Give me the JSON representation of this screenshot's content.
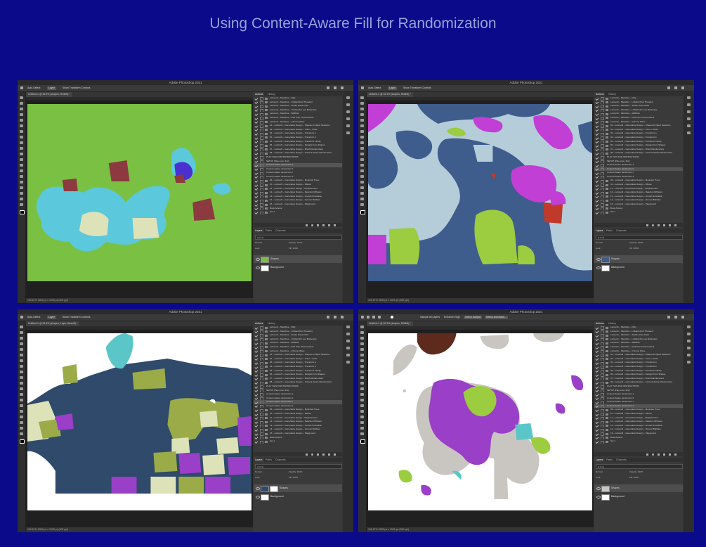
{
  "page": {
    "title": "Using Content-Aware Fill for Randomization"
  },
  "app": {
    "title": "Adobe Photoshop 2021"
  },
  "panels": {
    "actions_tab": "Actions",
    "history_tab": "History",
    "layers_tab": "Layers",
    "paths_tab": "Paths",
    "channels_tab": "Channels"
  },
  "layers": {
    "kind_label": "Q Kind",
    "blend_mode": "Normal",
    "opacity": "Opacity: 100%",
    "lock": "Lock:",
    "fill": "Fill: 100%",
    "shapes_label": "Shapes",
    "background_label": "Background"
  },
  "windows": [
    {
      "doc_tab": "Untitled-1 @ 33.3% (shapes, RGB/8) *",
      "status": "100.67%   3000 px x 1000 px (300 ppi)",
      "options": {
        "auto_select": "Auto-Select:",
        "layer": "Layer",
        "show_transform": "Show Transform Controls"
      },
      "actions": [
        {
          "label": "Lehoux9 – Sketches – Ditty",
          "type": "folder",
          "highlight": false
        },
        {
          "label": "Lehoux9 – Sketches – Untitled (Fort Thunder)",
          "type": "folder",
          "highlight": false
        },
        {
          "label": "Lehoux9 – Sketches – Textile Noise Field",
          "type": "folder",
          "highlight": false
        },
        {
          "label": "Lehoux9 – Sketches – Untitled (for Lea Borderies)",
          "type": "folder",
          "highlight": false
        },
        {
          "label": "Lehoux9 – Sketches – Wildflow",
          "type": "folder",
          "highlight": false
        },
        {
          "label": "Lehoux9 – Sketches – Red Print Chrome Rock",
          "type": "folder",
          "highlight": false
        },
        {
          "label": "Lehoux9 – Sketches – Chrome Wave",
          "type": "folder",
          "highlight": false
        },
        {
          "label": "01 – Lehoux9 – Generative Design – Shapes & Object Selection",
          "type": "folder",
          "highlight": false
        },
        {
          "label": "02 – Lehoux9 – Generative Design – Color + Grids",
          "type": "folder",
          "highlight": false
        },
        {
          "label": "03 – Lehoux9 – Generative Design – Transform a",
          "type": "folder",
          "highlight": false
        },
        {
          "label": "04 – Lehoux9 – Generative Design – Transform b",
          "type": "folder",
          "highlight": false
        },
        {
          "label": "05 – Lehoux9 – Generative Design – Transform Infinity",
          "type": "folder",
          "highlight": false
        },
        {
          "label": "06 – Lehoux9 – Generative Design – Designs from Shapes",
          "type": "folder",
          "highlight": false
        },
        {
          "label": "07 – Lehoux9 – Generative Design – Brush Randomizers",
          "type": "folder",
          "highlight": false
        },
        {
          "label": "08 – Lehoux9 – Generative Design – Content-Aware Randomizers",
          "type": "folder",
          "highlight": false
        },
        {
          "label": "PLAY THIS FOR INSTRUCTIONS",
          "type": "sub",
          "highlight": false
        },
        {
          "label": "SETUP (Play once, first)",
          "type": "sub",
          "highlight": false
        },
        {
          "label": "Content-Aware randomizer a",
          "type": "sub",
          "highlight": true
        },
        {
          "label": "Content-Aware randomizer b",
          "type": "sub",
          "highlight": false
        },
        {
          "label": "Content-Aware randomizer c",
          "type": "sub",
          "highlight": false
        },
        {
          "label": "Content-Aware randomizer d",
          "type": "sub",
          "highlight": false
        },
        {
          "label": "09 – Lehoux9 – Generative Design – Mountain Trees",
          "type": "folder",
          "highlight": false
        },
        {
          "label": "10 – Lehoux9 – Generative Design – Waves",
          "type": "folder",
          "highlight": false
        },
        {
          "label": "11 – Lehoux9 – Generative Design – Displacement",
          "type": "folder",
          "highlight": false
        },
        {
          "label": "12 – Lehoux9 – Generative Design – Reaction Diffusion",
          "type": "folder",
          "highlight": false
        },
        {
          "label": "13 – Lehoux9 – Generative Design – Growth Simulation",
          "type": "folder",
          "highlight": false
        },
        {
          "label": "14 – Lehoux9 – Generative Design – Voronoi Bubbles",
          "type": "folder",
          "highlight": false
        },
        {
          "label": "15 – Lehoux9 – Generative Design – Playground",
          "type": "folder",
          "highlight": false
        },
        {
          "label": "Book Actions",
          "type": "folder",
          "highlight": false
        },
        {
          "label": "Set 1",
          "type": "folder",
          "highlight": false
        }
      ]
    },
    {
      "doc_tab": "Untitled-1 @ 33.3% (shapes, RGB/8) *",
      "status": "100.67%   3000 px x 1000 px (300 ppi)",
      "options": {
        "auto_select": "Auto-Select:",
        "layer": "Layer",
        "show_transform": "Show Transform Controls"
      },
      "actions": [
        {
          "label": "Lehoux9 – Sketches – Ditty",
          "type": "folder",
          "highlight": false
        },
        {
          "label": "Lehoux9 – Sketches – Untitled (Fort Thunder)",
          "type": "folder",
          "highlight": false
        },
        {
          "label": "Lehoux9 – Sketches – Textile Noise Field",
          "type": "folder",
          "highlight": false
        },
        {
          "label": "Lehoux9 – Sketches – Untitled (for Lea Borderies)",
          "type": "folder",
          "highlight": false
        },
        {
          "label": "Lehoux9 – Sketches – Wildflow",
          "type": "folder",
          "highlight": false
        },
        {
          "label": "Lehoux9 – Sketches – Red Print Chrome Rock",
          "type": "folder",
          "highlight": false
        },
        {
          "label": "Lehoux9 – Sketches – Chrome Wave",
          "type": "folder",
          "highlight": false
        },
        {
          "label": "01 – Lehoux9 – Generative Design – Shapes & Object Selection",
          "type": "folder",
          "highlight": false
        },
        {
          "label": "02 – Lehoux9 – Generative Design – Color + Grids",
          "type": "folder",
          "highlight": false
        },
        {
          "label": "03 – Lehoux9 – Generative Design – Transform a",
          "type": "folder",
          "highlight": false
        },
        {
          "label": "04 – Lehoux9 – Generative Design – Transform b",
          "type": "folder",
          "highlight": false
        },
        {
          "label": "05 – Lehoux9 – Generative Design – Transform Infinity",
          "type": "folder",
          "highlight": false
        },
        {
          "label": "06 – Lehoux9 – Generative Design – Designs from Shapes",
          "type": "folder",
          "highlight": false
        },
        {
          "label": "07 – Lehoux9 – Generative Design – Brush Randomizers",
          "type": "folder",
          "highlight": false
        },
        {
          "label": "08 – Lehoux9 – Generative Design – Content-Aware Randomizers",
          "type": "folder",
          "highlight": false
        },
        {
          "label": "PLAY THIS FOR INSTRUCTIONS",
          "type": "sub",
          "highlight": false
        },
        {
          "label": "SETUP (Play once, first)",
          "type": "sub",
          "highlight": false
        },
        {
          "label": "Content-Aware randomizer a",
          "type": "sub",
          "highlight": false
        },
        {
          "label": "Content-Aware randomizer b",
          "type": "sub",
          "highlight": true
        },
        {
          "label": "Content-Aware randomizer c",
          "type": "sub",
          "highlight": false
        },
        {
          "label": "Content-Aware randomizer d",
          "type": "sub",
          "highlight": false
        },
        {
          "label": "09 – Lehoux9 – Generative Design – Mountain Trees",
          "type": "folder",
          "highlight": false
        },
        {
          "label": "10 – Lehoux9 – Generative Design – Waves",
          "type": "folder",
          "highlight": false
        },
        {
          "label": "11 – Lehoux9 – Generative Design – Displacement",
          "type": "folder",
          "highlight": false
        },
        {
          "label": "12 – Lehoux9 – Generative Design – Reaction Diffusion",
          "type": "folder",
          "highlight": false
        },
        {
          "label": "13 – Lehoux9 – Generative Design – Growth Simulation",
          "type": "folder",
          "highlight": false
        },
        {
          "label": "14 – Lehoux9 – Generative Design – Voronoi Bubbles",
          "type": "folder",
          "highlight": false
        },
        {
          "label": "15 – Lehoux9 – Generative Design – Playground",
          "type": "folder",
          "highlight": false
        },
        {
          "label": "Book Actions",
          "type": "folder",
          "highlight": false
        },
        {
          "label": "Set 1",
          "type": "folder",
          "highlight": false
        }
      ]
    },
    {
      "doc_tab": "Untitled-1 @ 33.3% (shapes, Layer Mask/8) *",
      "status": "100.67%   3000 px x 1000 px (300 ppi)",
      "options": {
        "auto_select": "Auto-Select:",
        "layer": "Layer",
        "show_transform": "Show Transform Controls"
      },
      "actions": [
        {
          "label": "Lehoux9 – Sketches – Ditty",
          "type": "folder",
          "highlight": false
        },
        {
          "label": "Lehoux9 – Sketches – Untitled (Fort Thunder)",
          "type": "folder",
          "highlight": false
        },
        {
          "label": "Lehoux9 – Sketches – Textile Noise Field",
          "type": "folder",
          "highlight": false
        },
        {
          "label": "Lehoux9 – Sketches – Untitled (for Lea Borderies)",
          "type": "folder",
          "highlight": false
        },
        {
          "label": "Lehoux9 – Sketches – Wildflow",
          "type": "folder",
          "highlight": false
        },
        {
          "label": "Lehoux9 – Sketches – Red Print Chrome Rock",
          "type": "folder",
          "highlight": false
        },
        {
          "label": "Lehoux9 – Sketches – Chrome Wave",
          "type": "folder",
          "highlight": false
        },
        {
          "label": "01 – Lehoux9 – Generative Design – Shapes & Object Selection",
          "type": "folder",
          "highlight": false
        },
        {
          "label": "02 – Lehoux9 – Generative Design – Color + Grids",
          "type": "folder",
          "highlight": false
        },
        {
          "label": "03 – Lehoux9 – Generative Design – Transform a",
          "type": "folder",
          "highlight": false
        },
        {
          "label": "04 – Lehoux9 – Generative Design – Transform b",
          "type": "folder",
          "highlight": false
        },
        {
          "label": "05 – Lehoux9 – Generative Design – Transform Infinity",
          "type": "folder",
          "highlight": false
        },
        {
          "label": "06 – Lehoux9 – Generative Design – Designs from Shapes",
          "type": "folder",
          "highlight": false
        },
        {
          "label": "07 – Lehoux9 – Generative Design – Brush Randomizers",
          "type": "folder",
          "highlight": false
        },
        {
          "label": "08 – Lehoux9 – Generative Design – Content-Aware Randomizers",
          "type": "folder",
          "highlight": false
        },
        {
          "label": "PLAY THIS FOR INSTRUCTIONS",
          "type": "sub",
          "highlight": false
        },
        {
          "label": "SETUP (Play once, first)",
          "type": "sub",
          "highlight": false
        },
        {
          "label": "Content-Aware randomizer a",
          "type": "sub",
          "highlight": false
        },
        {
          "label": "Content-Aware randomizer b",
          "type": "sub",
          "highlight": false
        },
        {
          "label": "Content-Aware randomizer c",
          "type": "sub",
          "highlight": true
        },
        {
          "label": "Content-Aware randomizer d",
          "type": "sub",
          "highlight": false
        },
        {
          "label": "09 – Lehoux9 – Generative Design – Mountain Trees",
          "type": "folder",
          "highlight": false
        },
        {
          "label": "10 – Lehoux9 – Generative Design – Waves",
          "type": "folder",
          "highlight": false
        },
        {
          "label": "11 – Lehoux9 – Generative Design – Displacement",
          "type": "folder",
          "highlight": false
        },
        {
          "label": "12 – Lehoux9 – Generative Design – Reaction Diffusion",
          "type": "folder",
          "highlight": false
        },
        {
          "label": "13 – Lehoux9 – Generative Design – Growth Simulation",
          "type": "folder",
          "highlight": false
        },
        {
          "label": "14 – Lehoux9 – Generative Design – Voronoi Bubbles",
          "type": "folder",
          "highlight": false
        },
        {
          "label": "15 – Lehoux9 – Generative Design – Playground",
          "type": "folder",
          "highlight": false
        },
        {
          "label": "Book Actions",
          "type": "folder",
          "highlight": false
        },
        {
          "label": "Set 1",
          "type": "folder",
          "highlight": false
        }
      ]
    },
    {
      "doc_tab": "Untitled-1 @ 33.3% (shapes, RGB/8) *",
      "status": "100.67%   3000 px x 1000 px (300 ppi)",
      "options": {
        "sample_all": "Sample All Layers",
        "enhance_edge": "Enhance Edge",
        "select_subject": "Select Subject",
        "select_mask": "Select and Mask..."
      },
      "actions": [
        {
          "label": "Lehoux9 – Sketches – Ditty",
          "type": "folder",
          "highlight": false
        },
        {
          "label": "Lehoux9 – Sketches – Untitled (Fort Thunder)",
          "type": "folder",
          "highlight": false
        },
        {
          "label": "Lehoux9 – Sketches – Textile Noise Field",
          "type": "folder",
          "highlight": false
        },
        {
          "label": "Lehoux9 – Sketches – Untitled (for Lea Borderies)",
          "type": "folder",
          "highlight": false
        },
        {
          "label": "Lehoux9 – Sketches – Wildflow",
          "type": "folder",
          "highlight": false
        },
        {
          "label": "Lehoux9 – Sketches – Red Print Chrome Rock",
          "type": "folder",
          "highlight": false
        },
        {
          "label": "Lehoux9 – Sketches – Chrome Wave",
          "type": "folder",
          "highlight": false
        },
        {
          "label": "01 – Lehoux9 – Generative Design – Shapes & Object Selection",
          "type": "folder",
          "highlight": false
        },
        {
          "label": "02 – Lehoux9 – Generative Design – Color + Grids",
          "type": "folder",
          "highlight": false
        },
        {
          "label": "03 – Lehoux9 – Generative Design – Transform a",
          "type": "folder",
          "highlight": false
        },
        {
          "label": "04 – Lehoux9 – Generative Design – Transform b",
          "type": "folder",
          "highlight": false
        },
        {
          "label": "05 – Lehoux9 – Generative Design – Transform Infinity",
          "type": "folder",
          "highlight": false
        },
        {
          "label": "06 – Lehoux9 – Generative Design – Designs from Shapes",
          "type": "folder",
          "highlight": false
        },
        {
          "label": "07 – Lehoux9 – Generative Design – Brush Randomizers",
          "type": "folder",
          "highlight": false
        },
        {
          "label": "08 – Lehoux9 – Generative Design – Content-Aware Randomizers",
          "type": "folder",
          "highlight": false
        },
        {
          "label": "PLAY THIS FOR INSTRUCTIONS",
          "type": "sub",
          "highlight": false
        },
        {
          "label": "SETUP (Play once, first)",
          "type": "sub",
          "highlight": false
        },
        {
          "label": "Content-Aware randomizer a",
          "type": "sub",
          "highlight": false
        },
        {
          "label": "Content-Aware randomizer b",
          "type": "sub",
          "highlight": false
        },
        {
          "label": "Content-Aware randomizer c",
          "type": "sub",
          "highlight": false
        },
        {
          "label": "Content-Aware randomizer d",
          "type": "sub",
          "highlight": true
        },
        {
          "label": "09 – Lehoux9 – Generative Design – Mountain Trees",
          "type": "folder",
          "highlight": false
        },
        {
          "label": "10 – Lehoux9 – Generative Design – Waves",
          "type": "folder",
          "highlight": false
        },
        {
          "label": "11 – Lehoux9 – Generative Design – Displacement",
          "type": "folder",
          "highlight": false
        },
        {
          "label": "12 – Lehoux9 – Generative Design – Reaction Diffusion",
          "type": "folder",
          "highlight": false
        },
        {
          "label": "13 – Lehoux9 – Generative Design – Growth Simulation",
          "type": "folder",
          "highlight": false
        },
        {
          "label": "14 – Lehoux9 – Generative Design – Voronoi Bubbles",
          "type": "folder",
          "highlight": false
        },
        {
          "label": "15 – Lehoux9 – Generative Design – Playground",
          "type": "folder",
          "highlight": false
        },
        {
          "label": "Book Actions",
          "type": "folder",
          "highlight": false
        },
        {
          "label": "Set 1",
          "type": "folder",
          "highlight": false
        }
      ]
    }
  ],
  "colors": {
    "page_bg": "#0a0a8a",
    "green": "#7ac143",
    "light_blue": "#5bc8dc",
    "maroon": "#8c3a3f",
    "cream": "#dde2b9",
    "violet": "#4a2fd1",
    "slate": "#3e5c8c",
    "pale_blue": "#b5ccd9",
    "magenta": "#c13fd4",
    "lime": "#9ccc3f",
    "navy": "#2f4a6b",
    "olive": "#9aab48",
    "purple": "#9a3fc7",
    "grey": "#c9c6c2",
    "brown": "#5e2a1e",
    "cyan": "#5bc6c8"
  }
}
